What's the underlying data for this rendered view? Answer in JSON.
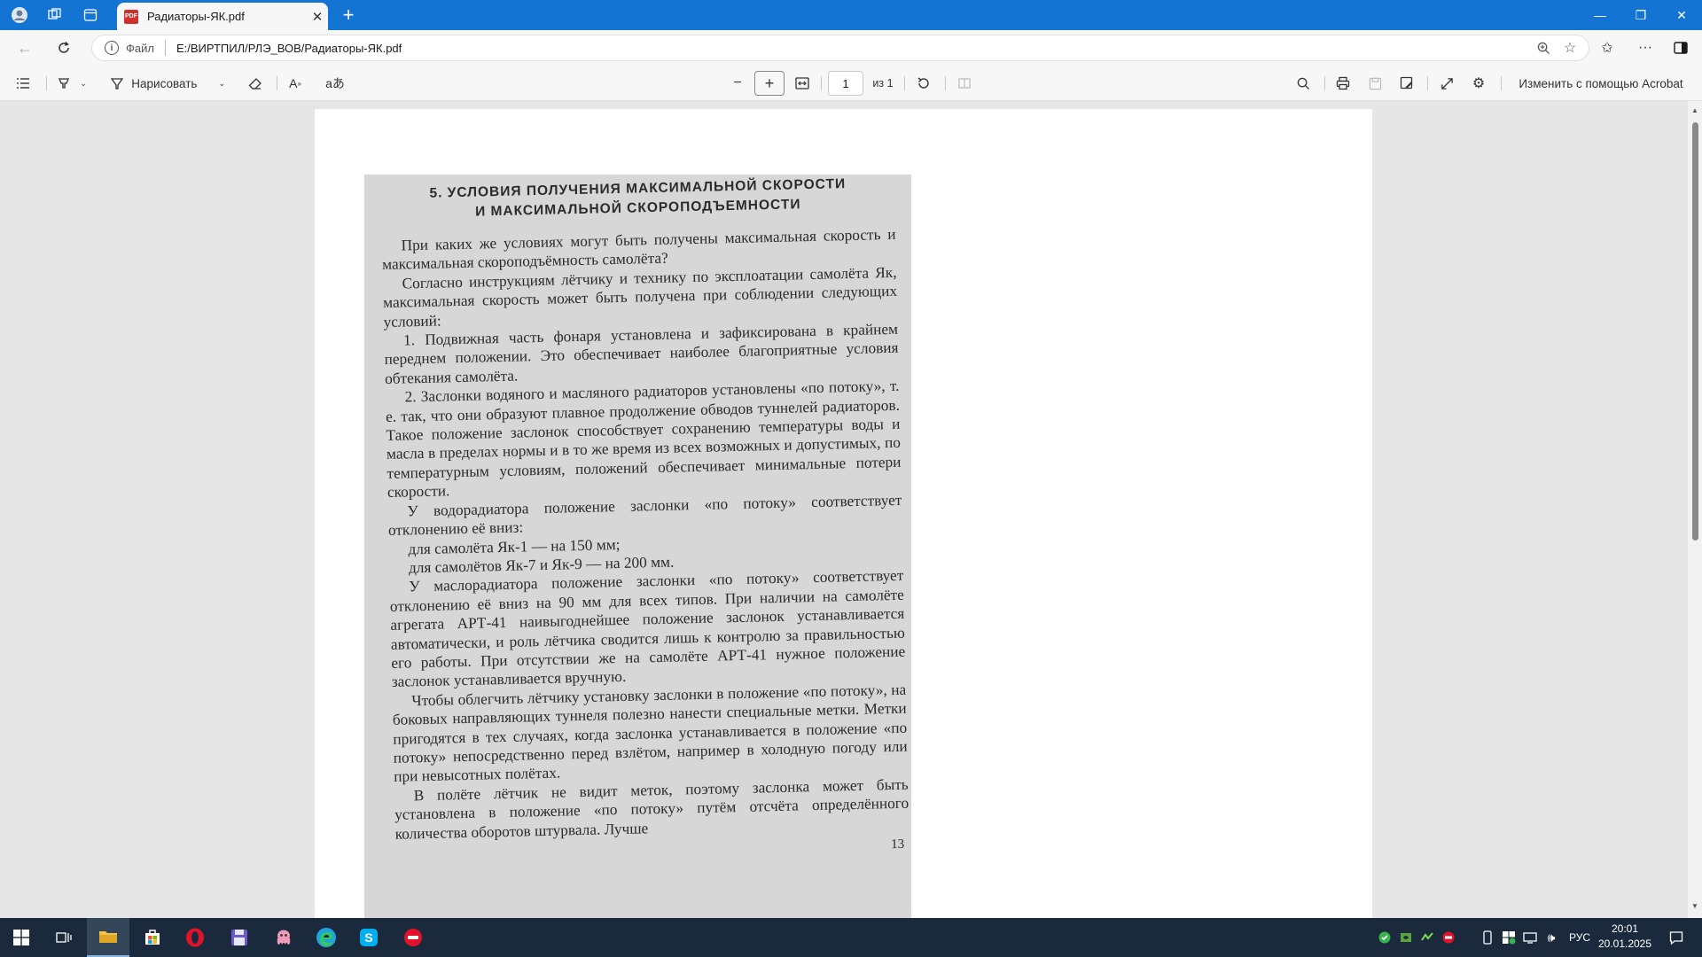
{
  "browser": {
    "tab_title": "Радиаторы-ЯК.pdf",
    "tab_icon_label": "PDF",
    "url_scheme": "Файл",
    "url": "E:/ВИРТПИЛ/РЛЭ_ВОВ/Радиаторы-ЯК.pdf"
  },
  "pdf_toolbar": {
    "draw_label": "Нарисовать",
    "page_current": "1",
    "page_total": "из 1",
    "edit_acrobat": "Изменить с помощью Acrobat"
  },
  "document": {
    "heading_line1": "5. УСЛОВИЯ ПОЛУЧЕНИЯ МАКСИМАЛЬНОЙ СКОРОСТИ",
    "heading_line2": "И МАКСИМАЛЬНОЙ СКОРОПОДЪЕМНОСТИ",
    "p1": "При каких же условиях могут быть получены максимальная скорость и максимальная скороподъёмность самолёта?",
    "p2": "Согласно инструкциям лётчику и технику по эксплоатации самолёта Як, максимальная скорость может быть получена при соблюдении следующих условий:",
    "p3": "1. Подвижная часть фонаря установлена и зафиксирована в крайнем переднем положении. Это обеспечивает наиболее благоприятные условия обтекания самолёта.",
    "p4": "2. Заслонки водяного и масляного радиаторов установлены «по потоку», т. е. так, что они образуют плавное продолжение обводов туннелей радиаторов. Такое положение заслонок способствует сохранению температуры воды и масла в пределах нормы и в то же время из всех возможных и допустимых, по температурным условиям, положений обеспечивает минимальные потери скорости.",
    "p5": "У водорадиатора положение заслонки «по потоку» соответствует отклонению её вниз:",
    "p6": "для самолёта Як-1 — на 150 мм;",
    "p7": "для самолётов Як-7 и Як-9 — на 200 мм.",
    "p8": "У маслорадиатора положение заслонки «по потоку» соответствует отклонению её вниз на 90 мм для всех типов. При наличии на самолёте агрегата АРТ-41 наивыгоднейшее положение заслонок устанавливается автоматически, и роль лётчика сводится лишь к контролю за правильностью его работы. При отсутствии же на самолёте АРТ-41 нужное положение заслонок устанавливается вручную.",
    "p9": "Чтобы облегчить лётчику установку заслонки в положение «по потоку», на боковых направляющих туннеля полезно нанести специальные метки. Метки пригодятся в тех случаях, когда заслонка устанавливается в положение «по потоку» непосредственно перед взлётом, например в холодную погоду или при невысотных полётах.",
    "p10": "В полёте лётчик не видит меток, поэтому заслонка может быть установлена в положение «по потоку» путём отсчёта определённого количества оборотов штурвала. Лучше",
    "page_number": "13"
  },
  "taskbar": {
    "lang": "РУС",
    "time": "20:01",
    "date": "20.01.2025"
  },
  "colors": {
    "titlebar": "#1474d4",
    "taskbar": "#1a2a3c",
    "pdf_red": "#d0312d"
  }
}
